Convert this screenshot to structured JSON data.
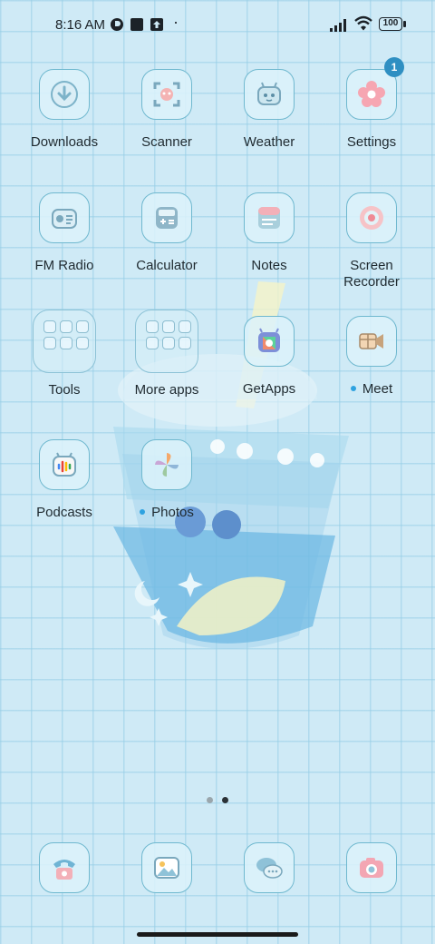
{
  "status_bar": {
    "time": "8:16 AM",
    "battery": "100",
    "notification_dot": "·"
  },
  "apps_row1": [
    {
      "label": "Downloads",
      "icon": "downloads-icon"
    },
    {
      "label": "Scanner",
      "icon": "scanner-icon"
    },
    {
      "label": "Weather",
      "icon": "weather-icon"
    },
    {
      "label": "Settings",
      "icon": "settings-icon",
      "badge": "1"
    }
  ],
  "apps_row2": [
    {
      "label": "FM Radio",
      "icon": "radio-icon"
    },
    {
      "label": "Calculator",
      "icon": "calculator-icon"
    },
    {
      "label": "Notes",
      "icon": "notes-icon"
    },
    {
      "label": "Screen Recorder",
      "icon": "screen-recorder-icon"
    }
  ],
  "apps_row3": [
    {
      "label": "Tools",
      "icon": "folder-icon"
    },
    {
      "label": "More apps",
      "icon": "folder-icon"
    },
    {
      "label": "GetApps",
      "icon": "getapps-icon"
    },
    {
      "label": "Meet",
      "icon": "meet-icon",
      "new_dot": true
    }
  ],
  "apps_row4": [
    {
      "label": "Podcasts",
      "icon": "podcasts-icon"
    },
    {
      "label": "Photos",
      "icon": "photos-icon",
      "new_dot": true
    }
  ],
  "pager": {
    "count": 2,
    "active": 1
  },
  "dock": [
    {
      "icon": "phone-icon"
    },
    {
      "icon": "gallery-icon"
    },
    {
      "icon": "messages-icon"
    },
    {
      "icon": "camera-icon"
    }
  ],
  "colors": {
    "background": "#cfeaf6",
    "icon_border": "#6fb8cf",
    "badge": "#2f8fc2",
    "new_dot": "#2ea2e0"
  }
}
